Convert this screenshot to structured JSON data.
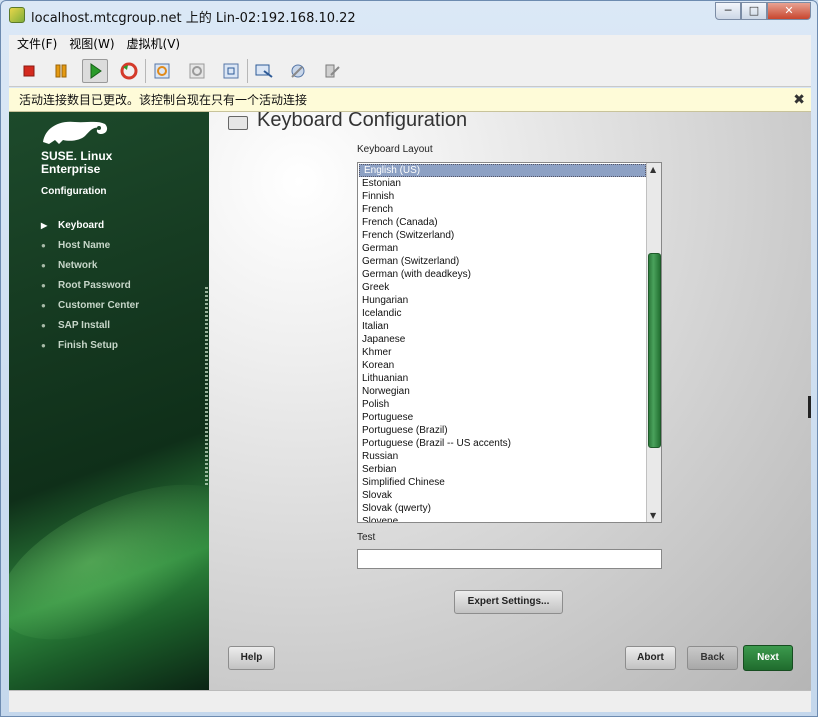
{
  "window": {
    "title": "localhost.mtcgroup.net 上的 Lin-02:192.168.10.22",
    "controls": [
      "─",
      "□",
      "✕"
    ]
  },
  "menu": [
    "文件(F)",
    "视图(W)",
    "虚拟机(V)"
  ],
  "toolbar": {
    "icons": [
      "stop-icon",
      "pause-icon",
      "play-icon",
      "reset-icon",
      "snapshot-icon",
      "snapshot-revert-icon",
      "snapshot-manager-icon",
      "console-icon",
      "settings-icon",
      "vm-settings-icon"
    ],
    "colors": {
      "stop": "#d42a1f",
      "pause": "#e59a12",
      "play": "#2a9b2a",
      "reset": "#d43a2a"
    }
  },
  "infobar": {
    "message": "活动连接数目已更改。该控制台现在只有一个活动连接",
    "close": "✖"
  },
  "sidebar": {
    "brand_line1": "SUSE. Linux",
    "brand_line2": "Enterprise",
    "section": "Configuration",
    "steps": [
      {
        "label": "Keyboard",
        "mark": "▶",
        "active": true
      },
      {
        "label": "Host Name",
        "mark": "●",
        "active": false
      },
      {
        "label": "Network",
        "mark": "●",
        "active": false
      },
      {
        "label": "Root Password",
        "mark": "●",
        "active": false
      },
      {
        "label": "Customer Center",
        "mark": "●",
        "active": false
      },
      {
        "label": "SAP Install",
        "mark": "●",
        "active": false
      },
      {
        "label": "Finish Setup",
        "mark": "●",
        "active": false
      }
    ]
  },
  "main": {
    "title": "Keyboard Configuration",
    "layout_label": "Keyboard Layout",
    "layouts": [
      "English (US)",
      "Estonian",
      "Finnish",
      "French",
      "French (Canada)",
      "French (Switzerland)",
      "German",
      "German (Switzerland)",
      "German (with deadkeys)",
      "Greek",
      "Hungarian",
      "Icelandic",
      "Italian",
      "Japanese",
      "Khmer",
      "Korean",
      "Lithuanian",
      "Norwegian",
      "Polish",
      "Portuguese",
      "Portuguese (Brazil)",
      "Portuguese (Brazil -- US accents)",
      "Russian",
      "Serbian",
      "Simplified Chinese",
      "Slovak",
      "Slovak (qwerty)",
      "Slovene"
    ],
    "selected_layout": "English (US)",
    "test_label": "Test",
    "test_value": "",
    "expert_button": "Expert Settings...",
    "help_button": "Help",
    "abort_button": "Abort",
    "back_button": "Back",
    "next_button": "Next"
  }
}
